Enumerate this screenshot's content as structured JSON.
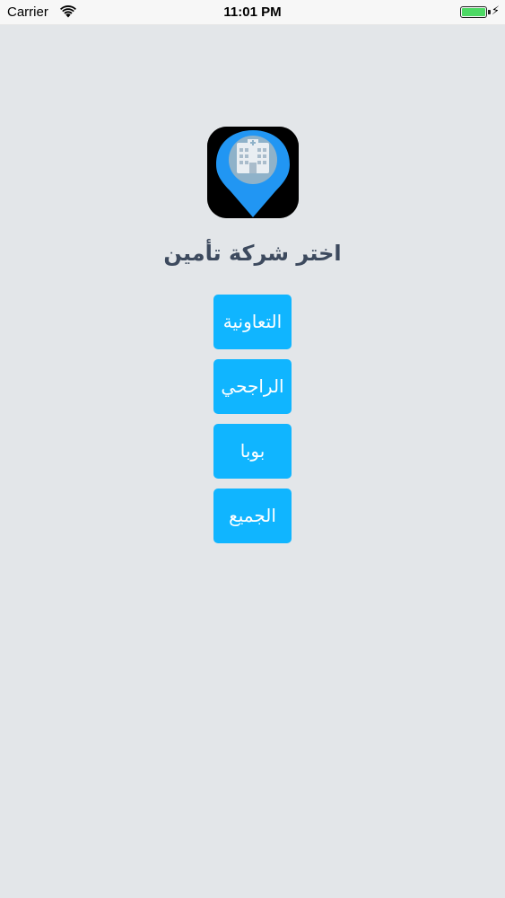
{
  "status_bar": {
    "carrier": "Carrier",
    "time": "11:01 PM",
    "battery_level": 1.0,
    "battery_color": "#4cd964",
    "icons": [
      "wifi-icon",
      "battery-icon",
      "charging-bolt-icon"
    ]
  },
  "logo": {
    "icon": "hospital-map-pin-icon",
    "pin_color": "#2196f3",
    "background_color": "#000000"
  },
  "title": "اختر شركة تأمين",
  "buttons": [
    {
      "label": "التعاونية"
    },
    {
      "label": "الراجحي"
    },
    {
      "label": "بوبا"
    },
    {
      "label": "الجميع"
    }
  ],
  "colors": {
    "accent": "#10b5ff",
    "background": "#e3e6e9",
    "title_text": "#3d4a5e"
  }
}
